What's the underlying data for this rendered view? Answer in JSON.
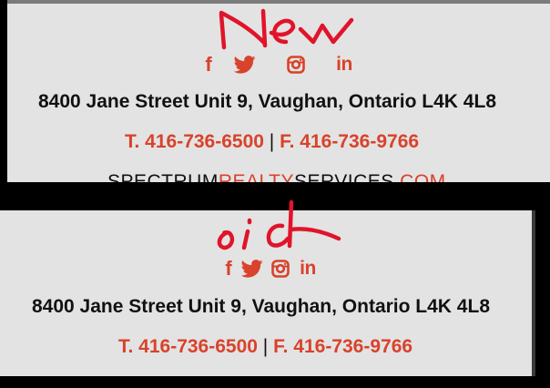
{
  "annotations": {
    "new_label": "New",
    "old_label": "old"
  },
  "new_signature": {
    "social_icons": [
      {
        "name": "facebook-icon",
        "glyph": "f"
      },
      {
        "name": "twitter-icon"
      },
      {
        "name": "instagram-icon"
      },
      {
        "name": "linkedin-icon",
        "glyph": "in"
      }
    ],
    "address": "8400 Jane Street Unit 9, Vaughan, Ontario L4K 4L8",
    "phone": "T. 416-736-6500",
    "separator": "|",
    "fax": "F. 416-736-9766",
    "website_part1": "SPECTRUM",
    "website_part2": "REALTY",
    "website_part3": "SERVICES",
    "website_part4": ".COM"
  },
  "old_signature": {
    "social_icons": [
      {
        "name": "facebook-icon",
        "glyph": "f"
      },
      {
        "name": "twitter-icon"
      },
      {
        "name": "instagram-icon"
      },
      {
        "name": "linkedin-icon",
        "glyph": "in"
      }
    ],
    "address": "8400 Jane Street Unit 9, Vaughan, Ontario L4K 4L8",
    "phone": "T. 416-736-6500",
    "separator": "|",
    "fax": "F. 416-736-9766"
  },
  "colors": {
    "accent": "#d9422b",
    "text": "#111111",
    "panel_bg": "#e3e3e3",
    "annotation_ink": "#e0142a",
    "background": "#000000"
  }
}
